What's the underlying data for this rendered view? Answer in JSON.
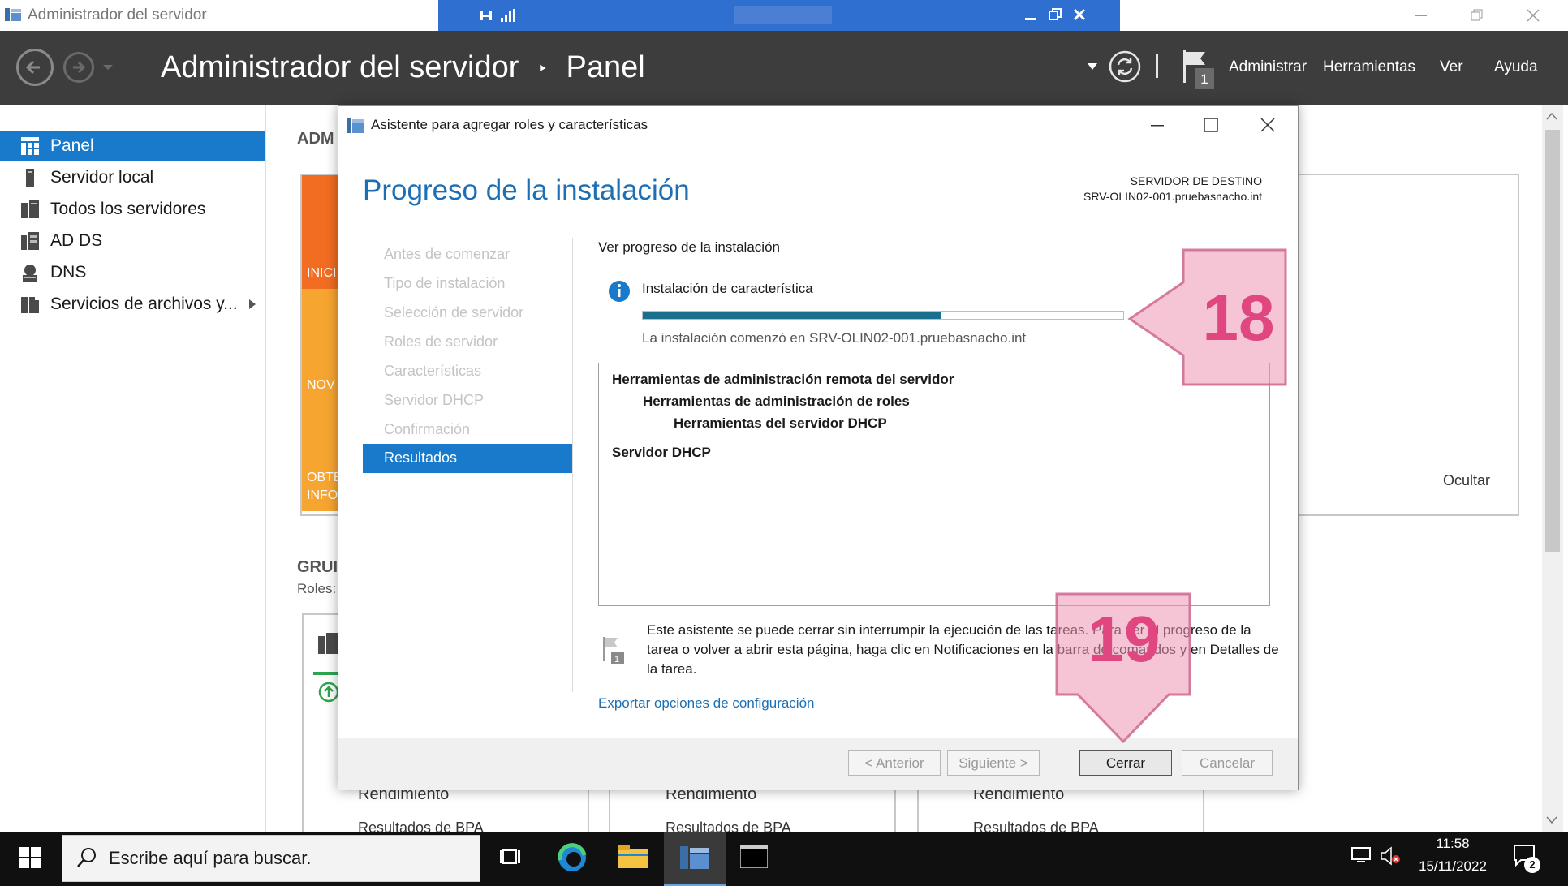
{
  "app": {
    "window_title": "Administrador del servidor",
    "header_title": "Administrador del servidor",
    "breadcrumb_sep": "‣",
    "breadcrumb_page": "Panel",
    "notification_count": "1",
    "menu": [
      "Administrar",
      "Herramientas",
      "Ver",
      "Ayuda"
    ]
  },
  "sidebar": {
    "items": [
      {
        "label": "Panel",
        "icon": "dashboard-icon",
        "active": true
      },
      {
        "label": "Servidor local",
        "icon": "server-icon"
      },
      {
        "label": "Todos los servidores",
        "icon": "servers-icon"
      },
      {
        "label": "AD DS",
        "icon": "ad-ds-icon"
      },
      {
        "label": "DNS",
        "icon": "dns-icon"
      },
      {
        "label": "Servicios de archivos y...",
        "icon": "file-services-icon"
      }
    ]
  },
  "background": {
    "section_prefix": "ADM",
    "tile_labels": [
      "INICI",
      "NOV",
      "OBTE",
      "INFO"
    ],
    "group_prefix": "GRUI",
    "roles_label": "Roles:",
    "hide_label": "Ocultar",
    "card_labels": [
      "Rendimiento",
      "Rendimiento",
      "Rendimiento"
    ],
    "card_sublabels": [
      "Resultados de BPA",
      "Resultados de BPA",
      "Resultados de BPA"
    ]
  },
  "dialog": {
    "title": "Asistente para agregar roles y características",
    "heading": "Progreso de la instalación",
    "dest_label": "SERVIDOR DE DESTINO",
    "dest_server": "SRV-OLIN02-001.pruebasnacho.int",
    "steps": [
      "Antes de comenzar",
      "Tipo de instalación",
      "Selección de servidor",
      "Roles de servidor",
      "Características",
      "Servidor DHCP",
      "Confirmación",
      "Resultados"
    ],
    "active_step": "Resultados",
    "section_title": "Ver progreso de la instalación",
    "status_title": "Instalación de característica",
    "progress": 0.62,
    "status_detail": "La instalación comenzó en SRV-OLIN02-001.pruebasnacho.int",
    "results": [
      {
        "text": "Herramientas de administración remota del servidor",
        "level": 0
      },
      {
        "text": "Herramientas de administración de roles",
        "level": 1
      },
      {
        "text": "Herramientas del servidor DHCP",
        "level": 2
      },
      {
        "text": "Servidor DHCP",
        "level": 0
      }
    ],
    "note": "Este asistente se puede cerrar sin interrumpir la ejecución de las tareas. Para ver el progreso de la tarea o volver a abrir esta página, haga clic en Notificaciones en la barra de comandos y en Detalles de la tarea.",
    "export_link": "Exportar opciones de configuración",
    "buttons": {
      "previous": "< Anterior",
      "next": "Siguiente >",
      "close": "Cerrar",
      "cancel": "Cancelar"
    }
  },
  "annotations": {
    "step_18": "18",
    "step_19": "19"
  },
  "taskbar": {
    "search_placeholder": "Escribe aquí para buscar.",
    "time": "11:58",
    "date": "15/11/2022",
    "notification_count": "2"
  },
  "colors": {
    "accent": "#1979ca",
    "header_bg": "#3d3d3d",
    "heading_blue": "#1c6fb4",
    "progress": "#1a6e8e",
    "annotation": "#e0467f"
  }
}
